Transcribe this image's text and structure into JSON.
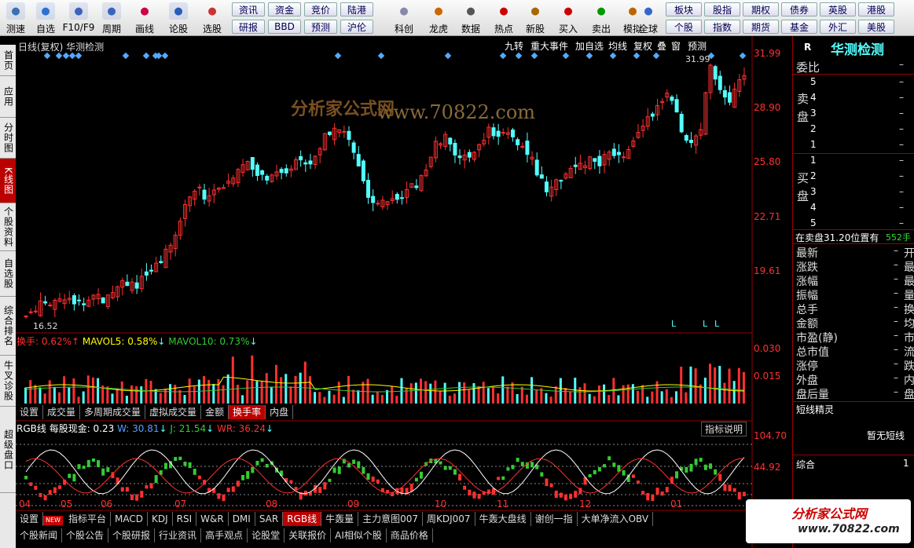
{
  "toolbar": {
    "items": [
      {
        "label": "测速",
        "icon": "speedometer-icon"
      },
      {
        "label": "自选",
        "icon": "star-icon"
      },
      {
        "label": "F10/F9",
        "icon": "f10-icon"
      },
      {
        "label": "周期",
        "icon": "clock-icon"
      },
      {
        "label": "画线",
        "icon": "pencil-icon"
      },
      {
        "label": "论股",
        "icon": "forum-icon"
      },
      {
        "label": "选股",
        "icon": "stock-select-icon"
      },
      {
        "label": "科创",
        "icon": "star-market-icon"
      },
      {
        "label": "龙虎",
        "icon": "dragon-tiger-icon"
      },
      {
        "label": "数据",
        "icon": "pe-data-icon"
      },
      {
        "label": "热点",
        "icon": "hot-icon"
      },
      {
        "label": "新股",
        "icon": "ipo-icon"
      },
      {
        "label": "买入",
        "icon": "buy-icon"
      },
      {
        "label": "卖出",
        "icon": "sell-icon"
      },
      {
        "label": "模拟",
        "icon": "hammer-icon"
      },
      {
        "label": "全球",
        "icon": "globe-icon"
      }
    ],
    "quick_top": [
      "资讯",
      "资金",
      "竞价",
      "陆港"
    ],
    "quick_bottom": [
      "研报",
      "BBD",
      "预测",
      "沪伦"
    ],
    "quick_right_top": [
      "板块",
      "股指",
      "期权",
      "债券",
      "英股",
      "港股"
    ],
    "quick_right_bottom": [
      "个股",
      "指数",
      "期货",
      "基金",
      "外汇",
      "美股"
    ]
  },
  "sidenav": [
    "首页",
    "应用",
    "分时图",
    "K线图",
    "个股资料",
    "自选股",
    "综合排名",
    "牛叉诊股",
    "超级盘口"
  ],
  "chart": {
    "title": "日线(复权)  华测检测",
    "buttons": [
      "九转",
      "重大事件",
      "加自选",
      "均线",
      "复权",
      "叠",
      "窗",
      "预测"
    ],
    "price_ticks": [
      "31.99",
      "28.90",
      "25.80",
      "22.71",
      "19.61"
    ],
    "high_label": "31.99",
    "low_label": "16.52",
    "volume_ticks": [
      "0.030",
      "0.015"
    ],
    "rgb_ticks": [
      "104.70",
      "44.92"
    ],
    "date_ticks": [
      "04",
      "05",
      "06",
      "07",
      "08",
      "09",
      "10",
      "11",
      "12",
      "01"
    ],
    "volume_legend": {
      "name": "换手",
      "value": "0.62%",
      "mavol5": "MAVOL5: 0.58%",
      "mavol10": "MAVOL10: 0.73%"
    },
    "volume_tabs": [
      "设置",
      "成交量",
      "多周期成交量",
      "虚拟成交量",
      "金额",
      "换手率",
      "内盘"
    ],
    "volume_active": "换手率",
    "rgb_legend": {
      "name": "RGB线",
      "cash": "每股现金: 0.23",
      "w": "W: 30.81",
      "j": "J: 21.54",
      "wr": "WR: 36.24"
    },
    "indicator_help": "指标说明",
    "indicator_tabs": [
      "设置",
      "指标平台",
      "MACD",
      "KDJ",
      "RSI",
      "W&R",
      "DMI",
      "SAR",
      "RGB线",
      "牛轰量",
      "主力意图007",
      "周KDJ007",
      "牛轰大盘线",
      "谢创一指",
      "大单净流入OBV"
    ],
    "indicator_active": "RGB线",
    "new_badge": "NEW",
    "news_tabs": [
      "个股新闻",
      "个股公告",
      "个股研报",
      "行业资讯",
      "高手观点",
      "论股堂",
      "关联报价",
      "AI相似个股",
      "商品价格"
    ],
    "watermark": "www.70822.com",
    "watermark_cn": "分析家公式网",
    "watermark_sub": "www.70822.com"
  },
  "chart_data": {
    "type": "candlestick",
    "ylim": [
      16.52,
      31.99
    ],
    "price_ticks": [
      31.99,
      28.9,
      25.8,
      22.71,
      19.61
    ],
    "high": 31.99,
    "low": 16.52,
    "close_series": [
      17.0,
      17.4,
      17.8,
      17.6,
      17.9,
      18.1,
      17.8,
      17.7,
      18.3,
      18.0,
      18.4,
      18.9,
      19.0,
      18.8,
      19.3,
      19.7,
      20.4,
      21.0,
      22.5,
      24.0,
      24.3,
      23.8,
      24.4,
      24.2,
      25.0,
      25.5,
      25.8,
      25.3,
      24.9,
      25.4,
      25.2,
      25.6,
      26.0,
      25.7,
      26.3,
      27.3,
      27.9,
      27.5,
      26.8,
      25.2,
      23.9,
      23.6,
      23.8,
      23.5,
      23.9,
      24.3,
      24.7,
      25.5,
      26.9,
      27.2,
      26.2,
      25.8,
      26.4,
      26.7,
      27.6,
      27.4,
      27.8,
      27.2,
      26.5,
      26.1,
      25.0,
      24.0,
      24.7,
      25.1,
      25.4,
      25.8,
      25.9,
      25.6,
      26.2,
      26.0,
      26.3,
      27.2,
      27.9,
      28.3,
      29.3,
      29.6,
      28.7,
      27.3,
      27.0,
      27.6,
      31.6,
      29.8,
      29.2,
      29.9,
      30.7
    ],
    "volume_ylim": [
      0,
      0.03
    ],
    "rgb_ylim": [
      44.92,
      104.7
    ],
    "x_labels": [
      "04",
      "05",
      "06",
      "07",
      "08",
      "09",
      "10",
      "11",
      "12",
      "01"
    ],
    "right_panel": {
      "title": "华测检测",
      "code": "R",
      "wei_bi": "委比",
      "sell_label": "卖盘",
      "buy_label": "买盘",
      "levels": [
        "5",
        "4",
        "3",
        "2",
        "1"
      ],
      "dash": "–",
      "sell_order": "在卖盘31.20位置有",
      "sell_order_qty": "552手",
      "fields_left": [
        "最新",
        "涨跌",
        "涨幅",
        "振幅",
        "总手",
        "金额",
        "市盈(静)",
        "总市值",
        "涨停",
        "外盘",
        "盘后量"
      ],
      "fields_right": [
        "开",
        "最",
        "最",
        "量",
        "换",
        "均",
        "市",
        "流",
        "跌",
        "内",
        "盘"
      ],
      "short_title": "短线精灵",
      "short_empty": "暂无短线",
      "summary": "综合",
      "summary_value": "1"
    }
  },
  "colors": {
    "up": "#ff3030",
    "down": "#54ffff",
    "axis": "#b00000",
    "bg": "#000000",
    "yellow": "#ffff00",
    "white": "#ffffff",
    "magenta": "#ff00ff"
  }
}
